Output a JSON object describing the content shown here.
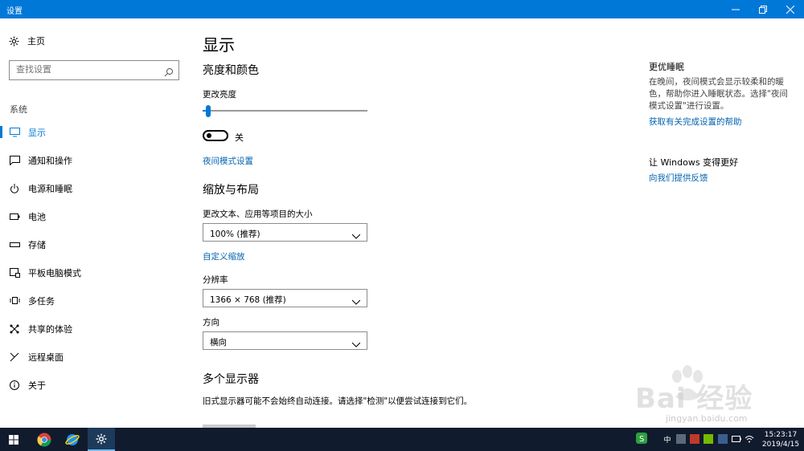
{
  "window": {
    "title": "设置"
  },
  "sidebar": {
    "home_label": "主页",
    "search_placeholder": "查找设置",
    "section_label": "系统",
    "items": [
      {
        "label": "显示",
        "icon": "monitor-icon",
        "active": true
      },
      {
        "label": "通知和操作",
        "icon": "notification-icon"
      },
      {
        "label": "电源和睡眠",
        "icon": "power-icon"
      },
      {
        "label": "电池",
        "icon": "battery-icon"
      },
      {
        "label": "存储",
        "icon": "storage-icon"
      },
      {
        "label": "平板电脑模式",
        "icon": "tablet-icon"
      },
      {
        "label": "多任务",
        "icon": "multitask-icon"
      },
      {
        "label": "共享的体验",
        "icon": "share-icon"
      },
      {
        "label": "远程桌面",
        "icon": "remote-icon"
      },
      {
        "label": "关于",
        "icon": "info-icon"
      }
    ]
  },
  "main": {
    "title": "显示",
    "brightness_section": "亮度和颜色",
    "brightness_label": "更改亮度",
    "brightness_value": 0.02,
    "night_light_state": "关",
    "night_light_link": "夜间模式设置",
    "scale_section": "缩放与布局",
    "scale_label": "更改文本、应用等项目的大小",
    "scale_value": "100% (推荐)",
    "custom_scale_link": "自定义缩放",
    "resolution_label": "分辨率",
    "resolution_value": "1366 × 768 (推荐)",
    "orientation_label": "方向",
    "orientation_value": "横向",
    "multi_section": "多个显示器",
    "multi_desc": "旧式显示器可能不会始终自动连接。请选择\"检测\"以便尝试连接到它们。"
  },
  "right_panel": {
    "sleep_title": "更优睡眠",
    "sleep_desc": "在晚间，夜间模式会显示较柔和的暖色，帮助你进入睡眠状态。选择\"夜间模式设置\"进行设置。",
    "sleep_link": "获取有关完成设置的帮助",
    "feedback_title": "让 Windows 变得更好",
    "feedback_link": "向我们提供反馈"
  },
  "taskbar": {
    "time": "15:23:17",
    "date": "2019/4/15",
    "ime": "中"
  },
  "watermark": {
    "text": "Bai 经验",
    "url": "jingyan.baidu.com"
  },
  "colors": {
    "accent": "#0078d7",
    "link": "#0063b1",
    "taskbar": "#101b2d"
  }
}
